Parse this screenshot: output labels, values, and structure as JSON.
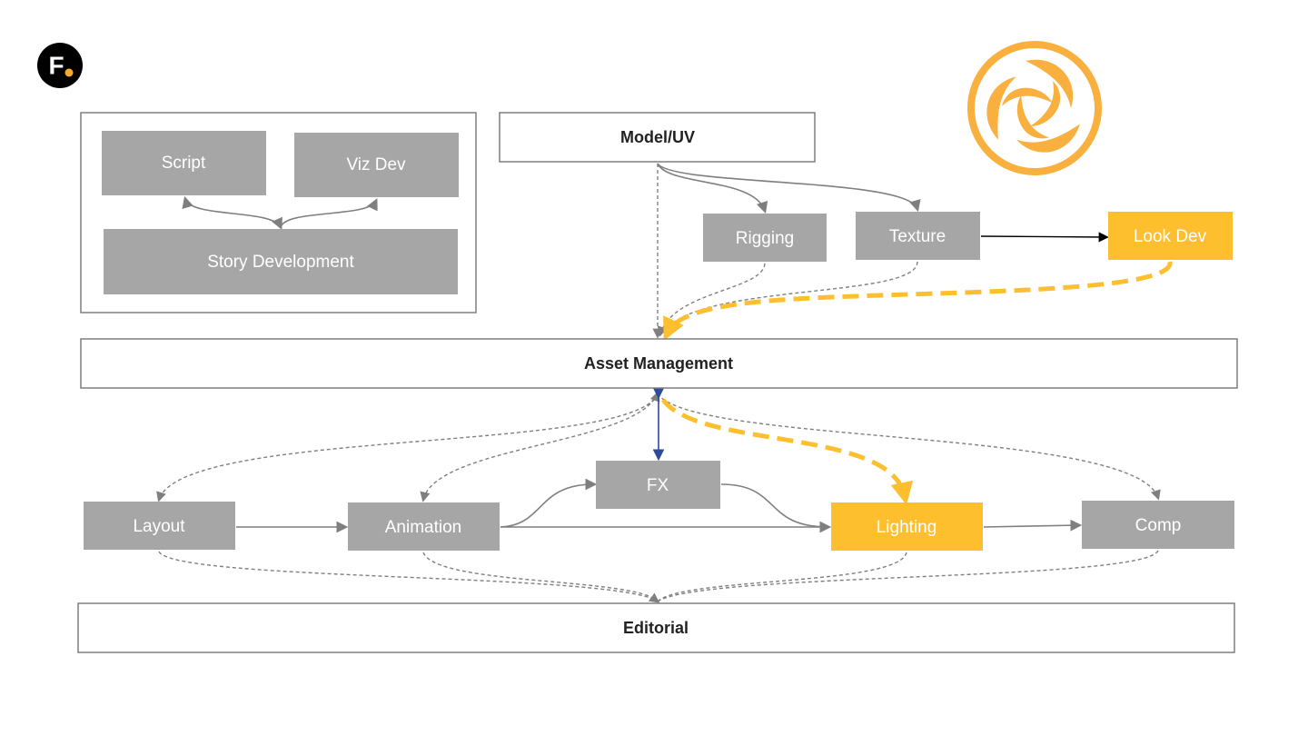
{
  "logos": {
    "left": "F.",
    "right": "orange-triskelion-logo"
  },
  "colors": {
    "node_grey": "#a6a6a6",
    "highlight": "#fdbf2d",
    "line": "#7f7f7f",
    "fx_link": "#2f4a9a"
  },
  "nodes": {
    "script": "Script",
    "vizdev": "Viz Dev",
    "story": "Story Development",
    "model": "Model/UV",
    "rigging": "Rigging",
    "texture": "Texture",
    "lookdev": "Look Dev",
    "asset": "Asset Management",
    "fx": "FX",
    "layout": "Layout",
    "animation": "Animation",
    "lighting": "Lighting",
    "comp": "Comp",
    "editorial": "Editorial"
  }
}
